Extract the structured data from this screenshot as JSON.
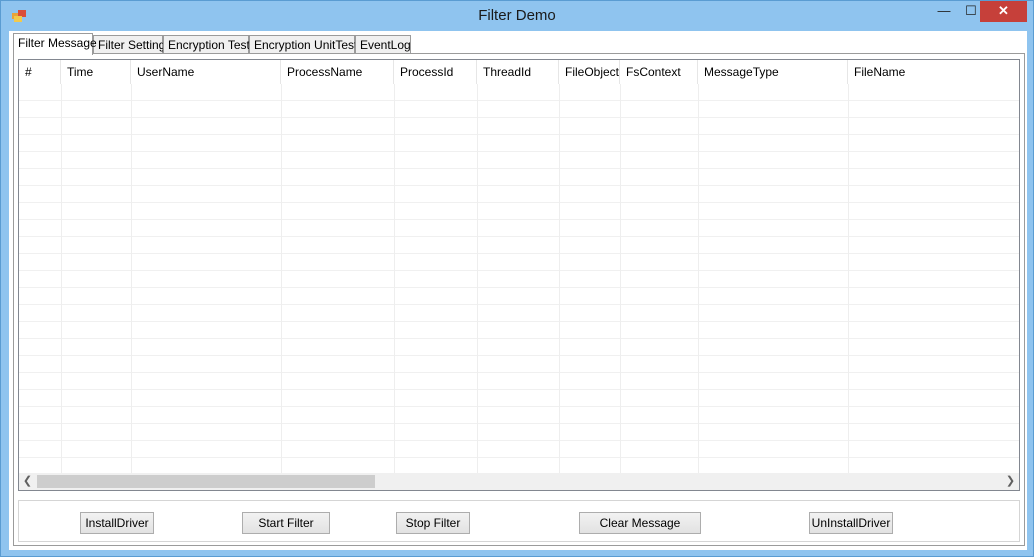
{
  "window": {
    "title": "Filter Demo",
    "minimize": "—",
    "maximize": "☐",
    "close": "✕"
  },
  "tabs": [
    {
      "label": "Filter Message",
      "active": true
    },
    {
      "label": "Filter Setting"
    },
    {
      "label": "Encryption Test"
    },
    {
      "label": "Encryption UnitTest"
    },
    {
      "label": "EventLog"
    }
  ],
  "grid": {
    "columns": [
      "#",
      "Time",
      "UserName",
      "ProcessName",
      "ProcessId",
      "ThreadId",
      "FileObject",
      "FsContext",
      "MessageType",
      "FileName"
    ]
  },
  "buttons": {
    "install": "InstallDriver",
    "start": "Start Filter",
    "stop": "Stop Filter",
    "clear": "Clear Message",
    "uninstall": "UnInstallDriver"
  }
}
